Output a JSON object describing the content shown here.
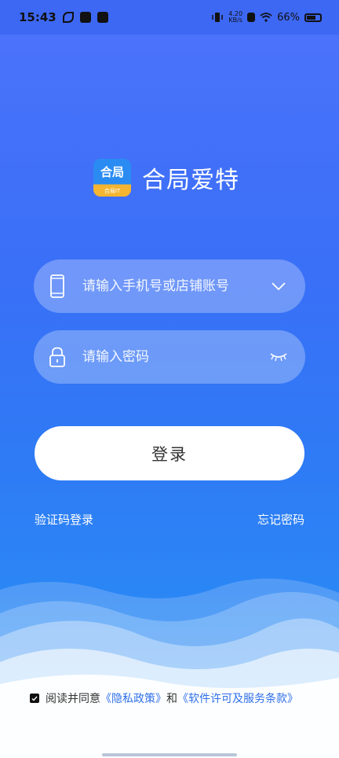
{
  "status_bar": {
    "time": "15:43",
    "net_speed_value": "4.20",
    "net_speed_unit": "KB/s",
    "battery": "66%"
  },
  "brand": {
    "logo_text": "合局",
    "logo_subtext": "合局IT",
    "app_name": "合局爱特"
  },
  "form": {
    "account_placeholder": "请输入手机号或店铺账号",
    "password_placeholder": "请输入密码",
    "login_label": "登录"
  },
  "links": {
    "sms_login": "验证码登录",
    "forgot_password": "忘记密码"
  },
  "agreement": {
    "prefix": "阅读并同意",
    "privacy": "《隐私政策》",
    "and": "和",
    "license": "《软件许可及服务条款》"
  },
  "colors": {
    "brand_blue": "#2a8cf3",
    "logo_yellow": "#f5b531",
    "link_blue": "#2f6fe9"
  }
}
